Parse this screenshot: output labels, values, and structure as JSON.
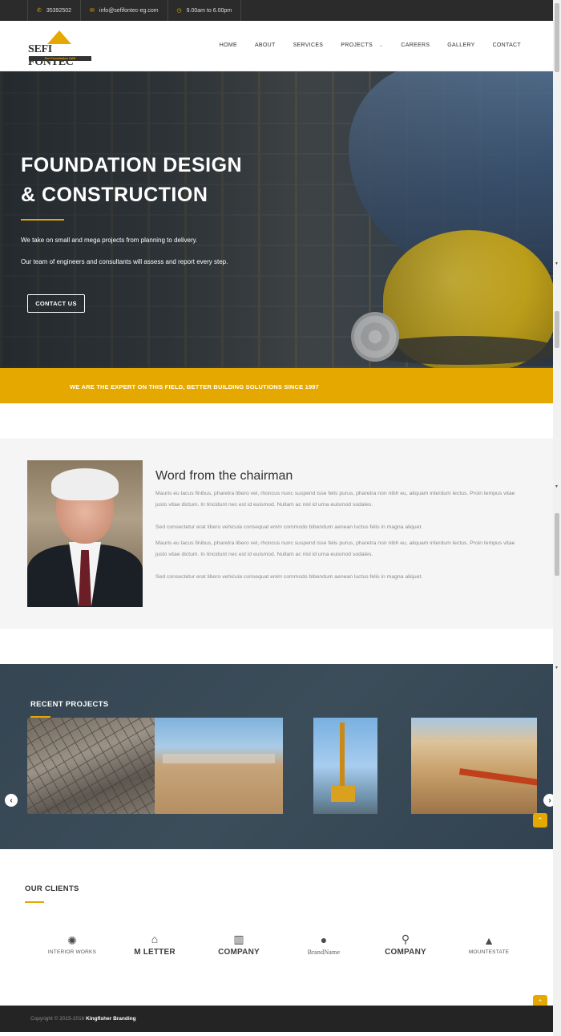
{
  "topbar": {
    "phone": "35392502",
    "email": "info@sefifontec-eg.com",
    "hours": "9.00am to 6.00pm"
  },
  "logo": {
    "name": "SEFI FONTEC",
    "tagline": "For Foundation SAE"
  },
  "nav": {
    "items": [
      "HOME",
      "ABOUT",
      "SERVICES",
      "PROJECTS",
      "CAREERS",
      "GALLERY",
      "CONTACT"
    ]
  },
  "hero": {
    "title_line1": "FOUNDATION DESIGN",
    "title_line2": "& CONSTRUCTION",
    "text1": "We take on small and mega projects from planning to delivery.",
    "text2": "Our team of engineers and consultants will assess and report every step.",
    "button": "CONTACT US"
  },
  "band": {
    "text": "WE ARE THE EXPERT ON THIS FIELD, BETTER BUILDING SOLUTIONS SINCE 1997"
  },
  "chairman": {
    "title": "Word from the chairman",
    "p1": "Mauris eu lacus finibus, pharetra libero vel, rhoncus nunc suspend isse felis purus, pharetra non nibh eu, aliquam interdum lectus. Proin tempus vitae justo vitae dictum. In tincidunt nec est id euismod. Nullam ac nisl id urna euismod sodales.",
    "p2_a": "Sed consectetur erat libero ",
    "p2_em": "vehicula consequat enim",
    "p2_b": " commodo bibendum aenean luctus felis in magna aliquet.",
    "p3": "Mauris eu lacus finibus, pharetra libero vel, rhoncus nunc suspend isse felis purus, pharetra non nibh eu, aliquam interdum lectus. Proin tempus vitae justo vitae dictum. In tincidunt nec est id euismod. Nullam ac nisl id urna euismod sodales.",
    "p4_a": "Sed consectetur erat libero ",
    "p4_em": "vehicula consequat enim",
    "p4_b": " commodo bibendum aenean luctus felis in magna aliquet."
  },
  "recent": {
    "title": "RECENT PROJECTS"
  },
  "clients": {
    "title": "OUR CLIENTS",
    "items": [
      {
        "name": "INTERIOR WORKS",
        "icon": "gear-ring-icon"
      },
      {
        "name": "M LETTER",
        "icon": "winged-m-icon"
      },
      {
        "name": "COMPANY",
        "icon": "building-icon"
      },
      {
        "name": "BrandName",
        "icon": "city-circle-icon"
      },
      {
        "name": "COMPANY",
        "icon": "bicycle-icon"
      },
      {
        "name": "MOUNTESTATE",
        "icon": "mountain-house-icon"
      }
    ]
  },
  "footer": {
    "copyright": "Copyright © 2015-2016",
    "brand": "Kingfisher Branding"
  },
  "colors": {
    "accent": "#e5a800",
    "dark": "#2b2b2b",
    "recent_bg": "#3c4d5a"
  }
}
